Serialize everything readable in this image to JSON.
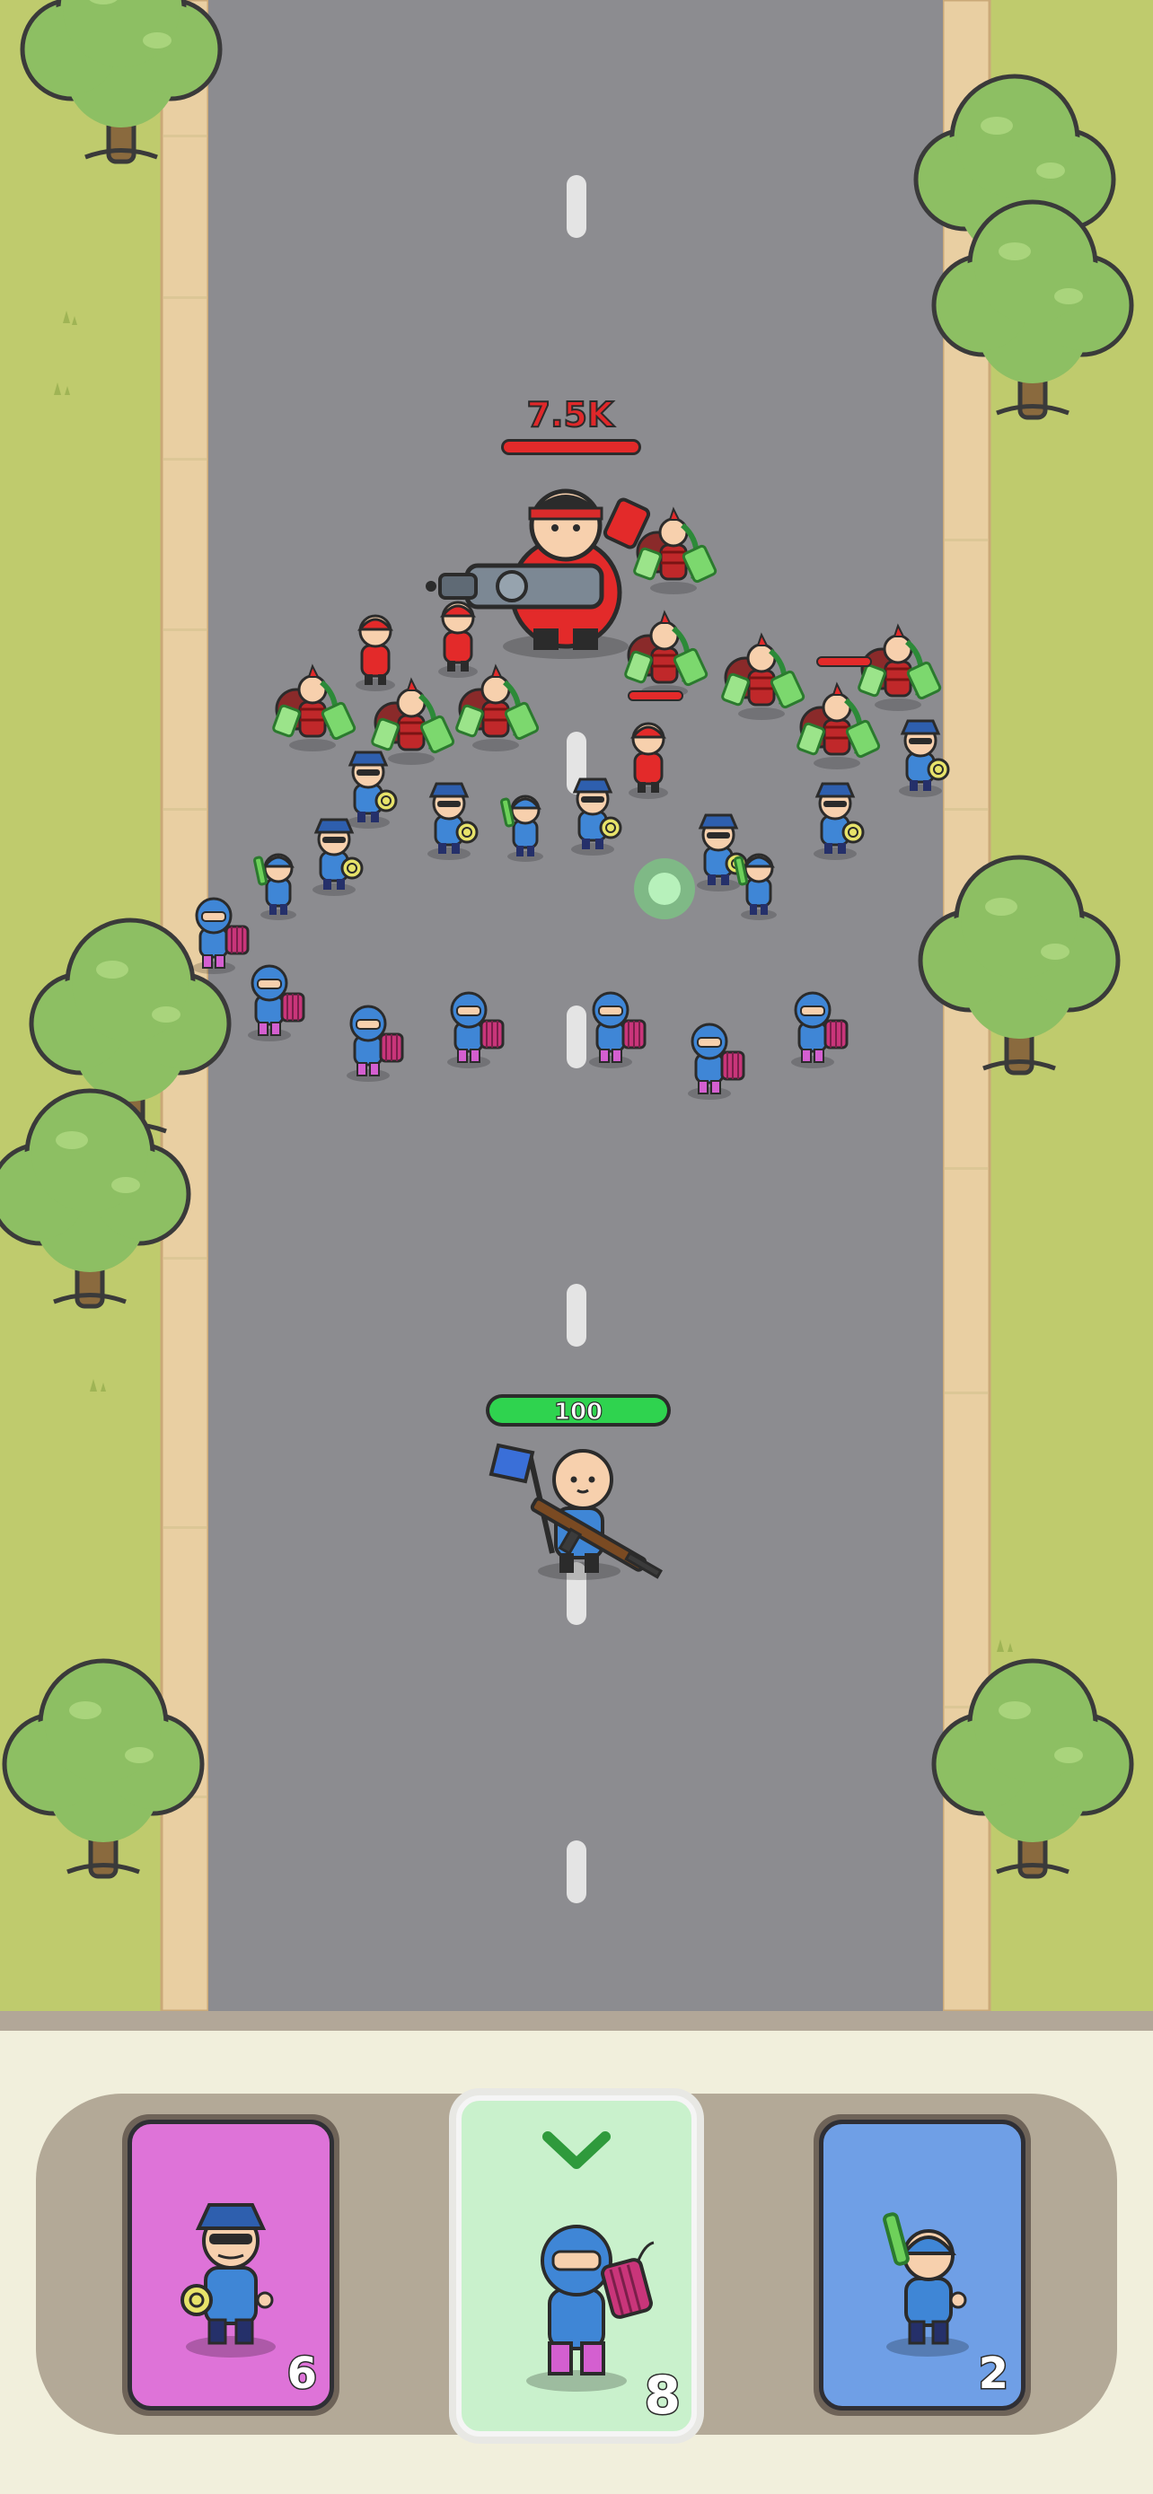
{
  "boss": {
    "hp_label": "7.5K",
    "hp_fill": 1.0
  },
  "player": {
    "hp_label": "100",
    "hp_fill": 1.0
  },
  "cards": [
    {
      "name": "police-shield-unit",
      "count": "6",
      "color": "#de73d8",
      "selected": false
    },
    {
      "name": "dynamite-unit",
      "count": "8",
      "color": "#c9f1cc",
      "selected": true
    },
    {
      "name": "bottle-thrower-unit",
      "count": "2",
      "color": "#6f9fe6",
      "selected": false
    }
  ],
  "colors": {
    "road": "#8c8c90",
    "grass": "#bfcb6d",
    "sidewalk": "#e9cfa2",
    "tree_leaf": "#8dbf63",
    "enemy_red": "#e32a2a",
    "ally_blue": "#3f86d6",
    "ally_pink": "#d45fd0",
    "hp_green": "#2fd34f",
    "hp_red": "#e32a2a"
  }
}
